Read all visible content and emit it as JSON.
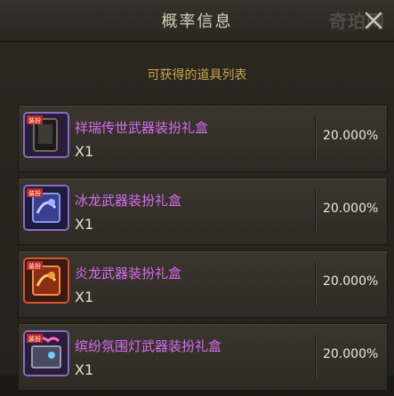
{
  "dialog": {
    "title": "概率信息",
    "close_icon": "close-icon",
    "subtitle": "可获得的道具列表"
  },
  "watermark": "奇珀网",
  "items": [
    {
      "name": "祥瑞传世武器装扮礼盒",
      "quantity": "X1",
      "probability": "20.000%",
      "icon": "purple-weapon-box-icon",
      "frame_color": "#8a6cc0"
    },
    {
      "name": "冰龙武器装扮礼盒",
      "quantity": "X1",
      "probability": "20.000%",
      "icon": "ice-dragon-box-icon",
      "frame_color": "#8a6cc0"
    },
    {
      "name": "炎龙武器装扮礼盒",
      "quantity": "X1",
      "probability": "20.000%",
      "icon": "fire-dragon-box-icon",
      "frame_color": "#d6542a"
    },
    {
      "name": "缤纷氛围灯武器装扮礼盒",
      "quantity": "X1",
      "probability": "20.000%",
      "icon": "colorful-light-box-icon",
      "frame_color": "#8a6cc0"
    }
  ],
  "colors": {
    "item_name": "#d86bf0",
    "subtitle": "#c9a64e",
    "title": "#d9cfb8"
  }
}
